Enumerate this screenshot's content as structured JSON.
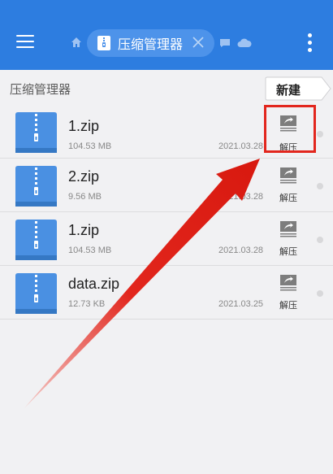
{
  "topbar": {
    "tab_label": "压缩管理器"
  },
  "breadcrumb": "压缩管理器",
  "new_button_label": "新建",
  "files": [
    {
      "name": "1.zip",
      "size": "104.53 MB",
      "date": "2021.03.28",
      "extract_label": "解压"
    },
    {
      "name": "2.zip",
      "size": "9.56 MB",
      "date": "2021.03.28",
      "extract_label": "解压"
    },
    {
      "name": "1.zip",
      "size": "104.53 MB",
      "date": "2021.03.28",
      "extract_label": "解压"
    },
    {
      "name": "data.zip",
      "size": "12.73 KB",
      "date": "2021.03.25",
      "extract_label": "解压"
    }
  ],
  "colors": {
    "accent": "#2d7de0",
    "file_icon": "#4a90e2",
    "annotation": "#e2261d"
  }
}
